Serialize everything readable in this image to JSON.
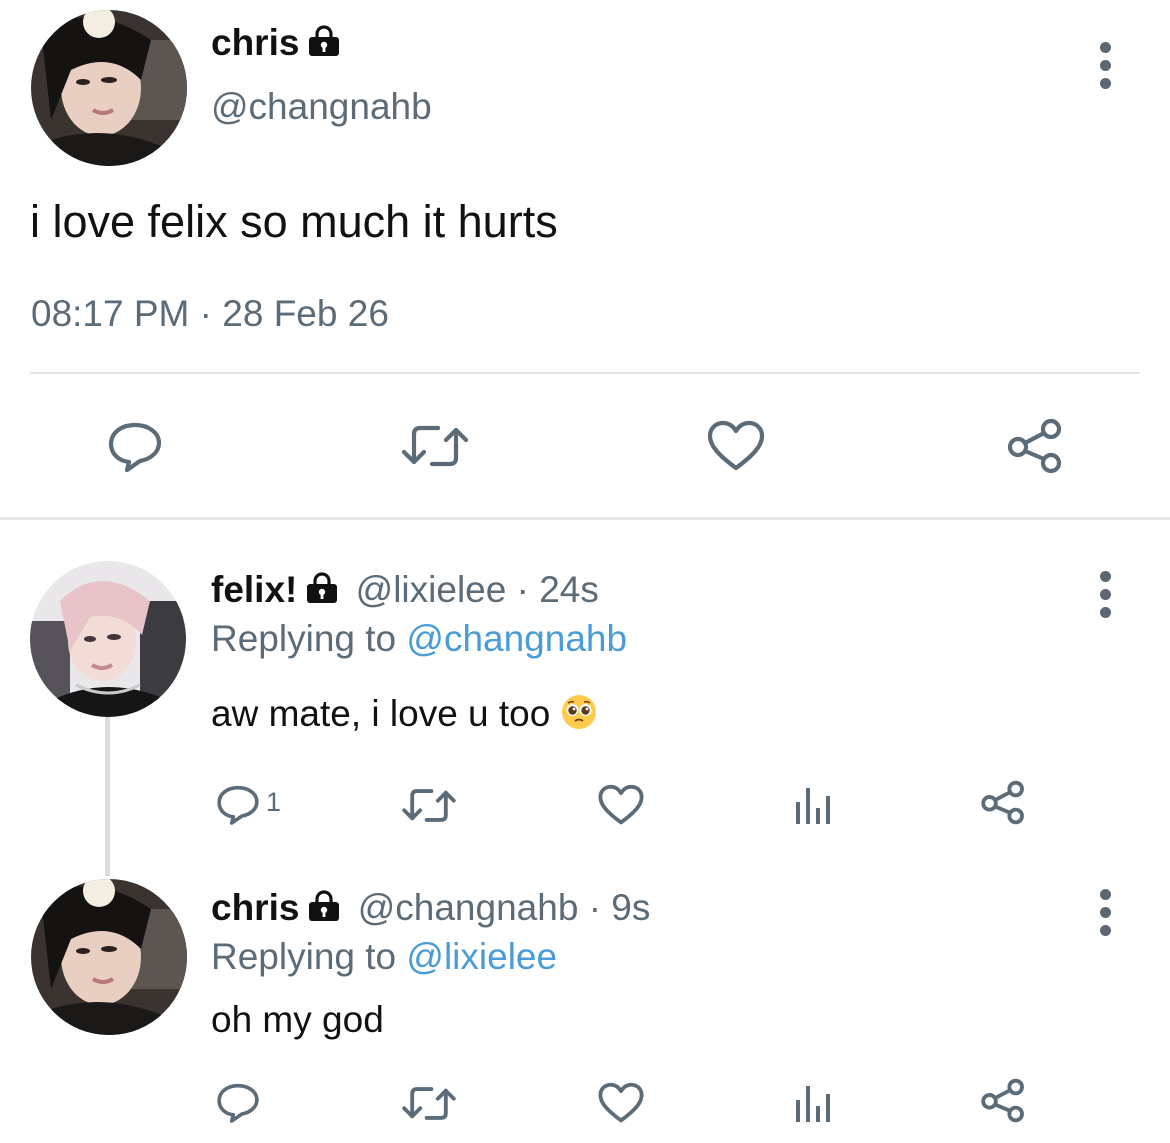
{
  "main_tweet": {
    "display_name": "chris",
    "handle": "@changnahb",
    "text": "i love felix so much it hurts",
    "time": "08:17 PM",
    "separator": "·",
    "date": "28 Feb 26"
  },
  "replies": [
    {
      "display_name": "felix!",
      "handle": "@lixielee",
      "separator": "·",
      "age": "24s",
      "replying_prefix": "Replying to",
      "replying_to": "@changnahb",
      "text": "aw mate, i love u too",
      "emoji": "pleading-face",
      "reply_count": "1"
    },
    {
      "display_name": "chris",
      "handle": "@changnahb",
      "separator": "·",
      "age": "9s",
      "replying_prefix": "Replying to",
      "replying_to": "@lixielee",
      "text": "oh my god"
    }
  ],
  "colors": {
    "icon_gray": "#5b6b78",
    "link_blue": "#4a9cd9",
    "divider": "#e3e6e8"
  }
}
